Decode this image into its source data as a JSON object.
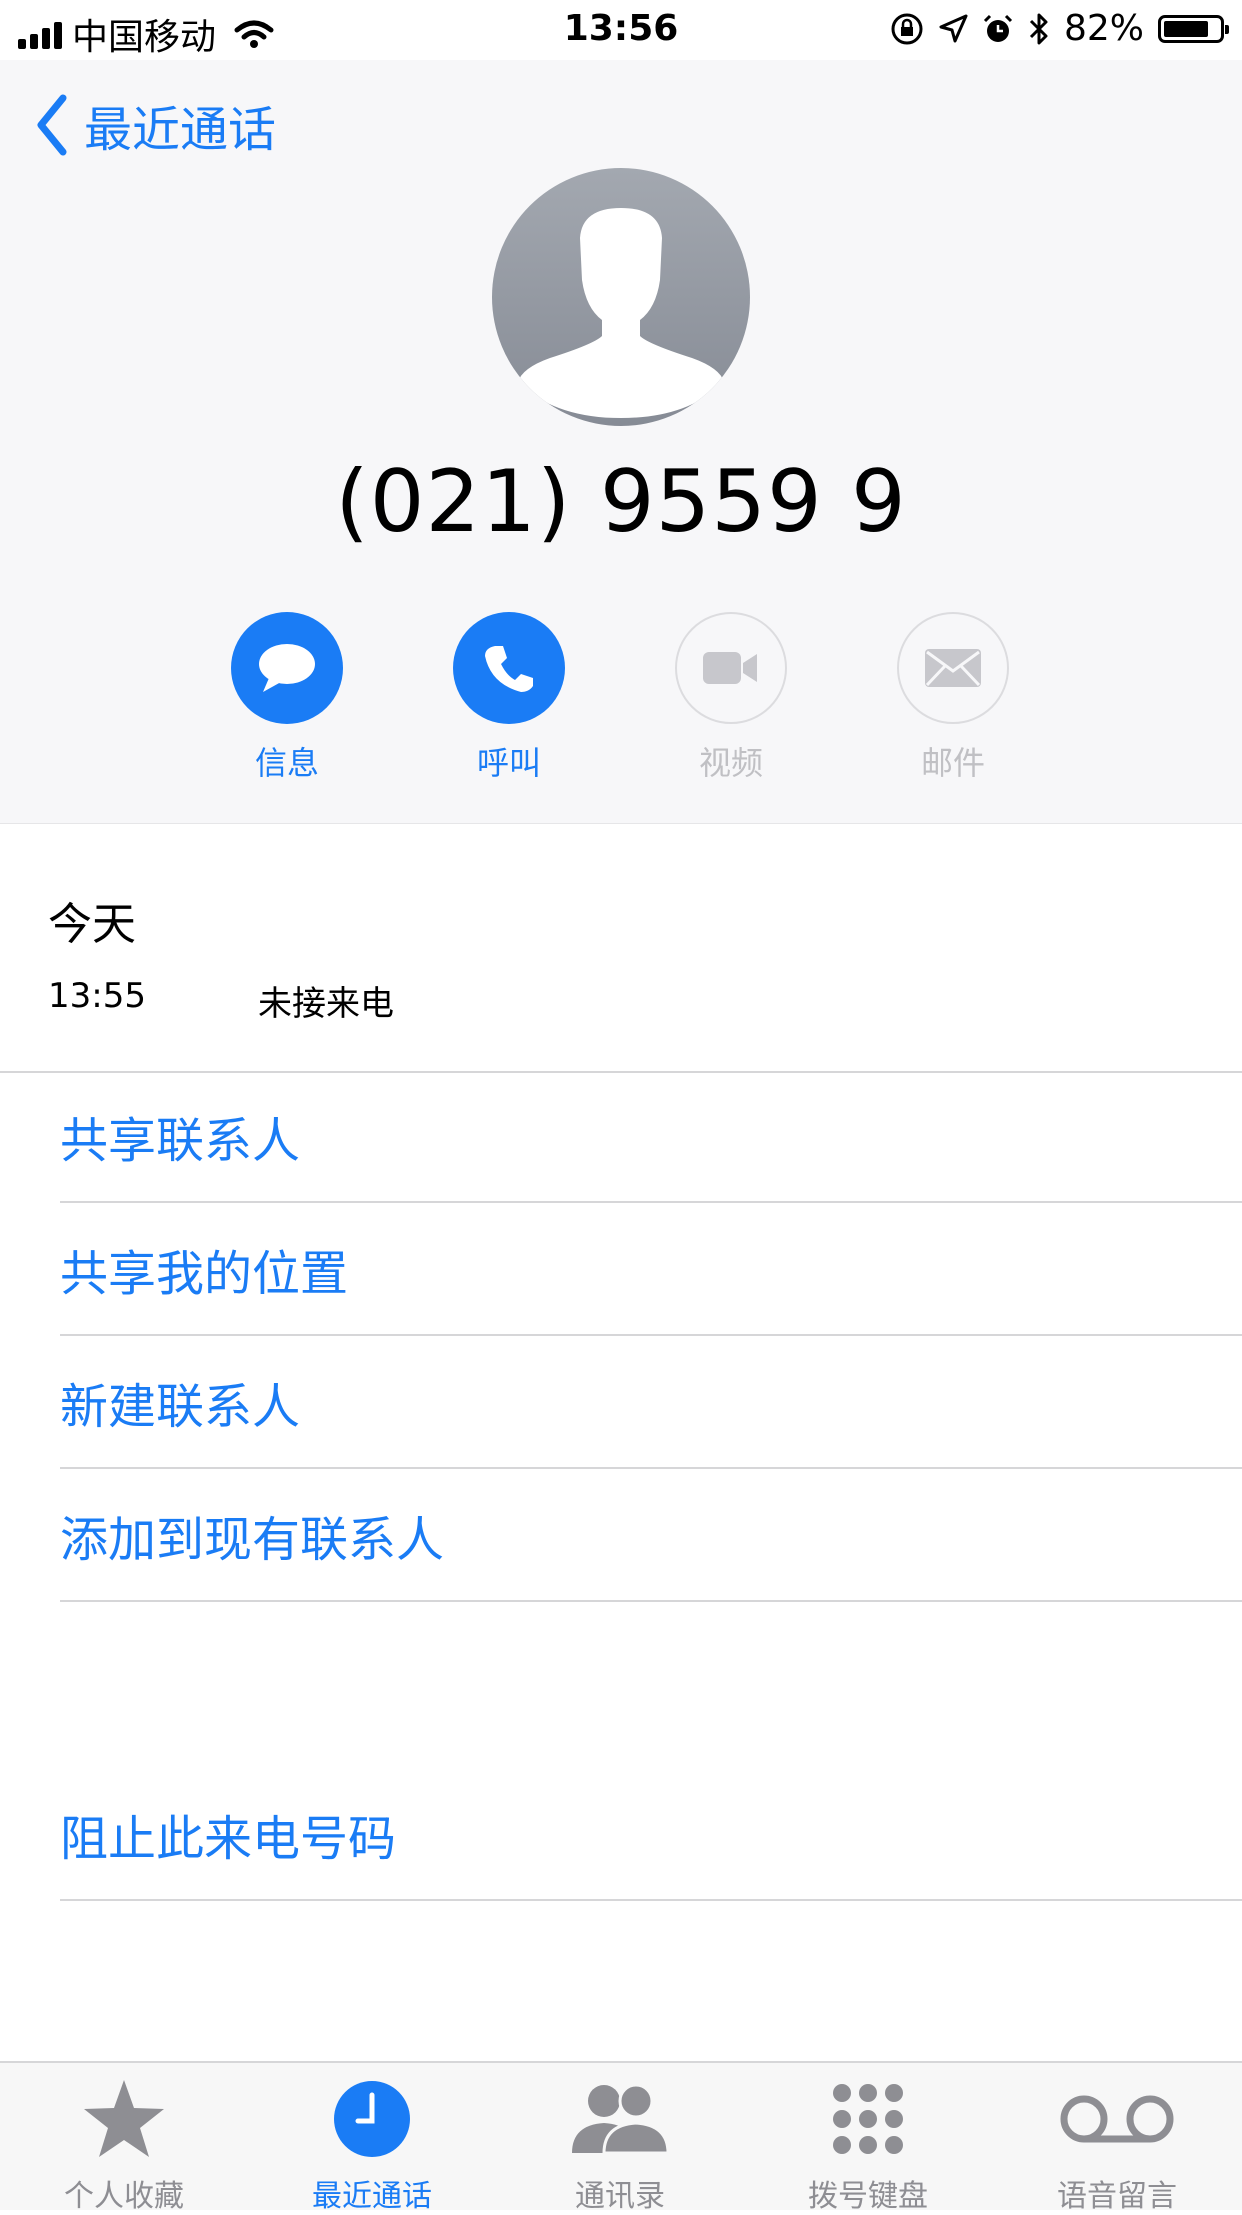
{
  "status_bar": {
    "carrier": "中国移动",
    "time": "13:56",
    "battery_percent": "82%",
    "battery_level": 0.82
  },
  "nav": {
    "back_label": "最近通话"
  },
  "contact": {
    "number": "(021) 9559 9"
  },
  "actions": [
    {
      "label": "信息",
      "icon": "message-icon",
      "enabled": true
    },
    {
      "label": "呼叫",
      "icon": "phone-icon",
      "enabled": true
    },
    {
      "label": "视频",
      "icon": "video-icon",
      "enabled": false
    },
    {
      "label": "邮件",
      "icon": "mail-icon",
      "enabled": false
    }
  ],
  "recent": {
    "day": "今天",
    "time": "13:55",
    "type": "未接来电"
  },
  "menu": {
    "share_contact": "共享联系人",
    "share_location": "共享我的位置",
    "new_contact": "新建联系人",
    "add_existing": "添加到现有联系人",
    "block": "阻止此来电号码"
  },
  "tabs": [
    {
      "label": "个人收藏",
      "icon": "star-icon",
      "active": false
    },
    {
      "label": "最近通话",
      "icon": "clock-icon",
      "active": true
    },
    {
      "label": "通讯录",
      "icon": "contacts-icon",
      "active": false
    },
    {
      "label": "拨号键盘",
      "icon": "keypad-icon",
      "active": false
    },
    {
      "label": "语音留言",
      "icon": "voicemail-icon",
      "active": false
    }
  ],
  "colors": {
    "accent": "#1a7cf5",
    "inactive": "#8e8e93",
    "disabled": "#c0c0c4"
  }
}
